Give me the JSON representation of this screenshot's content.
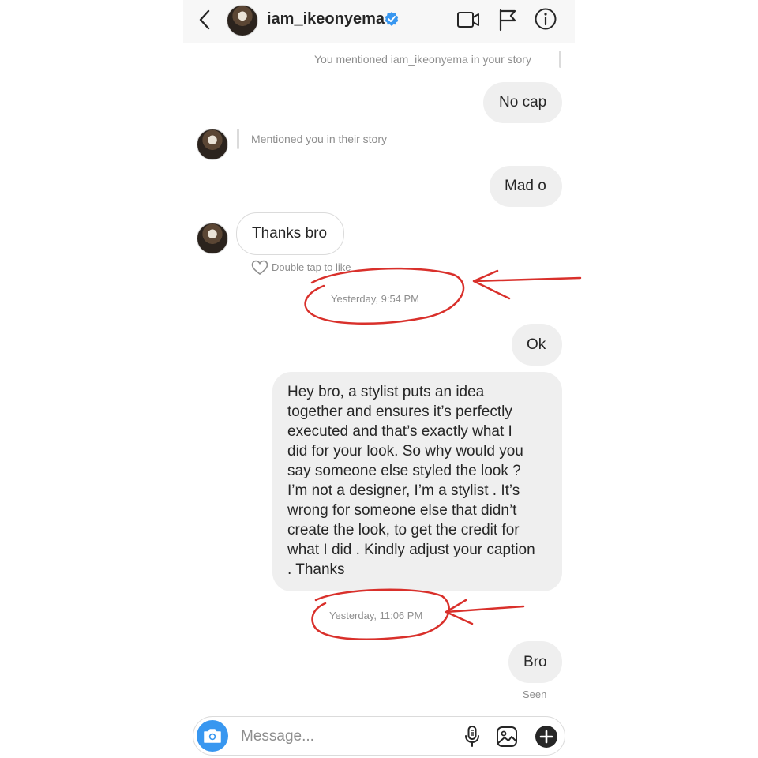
{
  "header": {
    "username": "iam_ikeonyema"
  },
  "messages": {
    "you_mentioned": "You mentioned iam_ikeonyema in your story",
    "no_cap": "No cap",
    "mentioned_you": "Mentioned you in their story",
    "mad_o": "Mad o",
    "thanks_bro": "Thanks bro",
    "double_tap": "Double tap to like",
    "time1": "Yesterday, 9:54 PM",
    "ok": "Ok",
    "long_lines": [
      "Hey bro, a stylist puts an idea",
      "together and ensures it’s perfectly",
      "executed and that’s exactly what I",
      "did for your look. So why would you",
      "say someone else styled the look ?",
      "I’m not a designer, I’m a stylist . It’s",
      "wrong for someone else that didn’t",
      "create the look, to get the credit for",
      "what I did . Kindly adjust your caption",
      ". Thanks"
    ],
    "time2": "Yesterday, 11:06 PM",
    "bro": "Bro",
    "seen": "Seen"
  },
  "composer": {
    "placeholder": "Message..."
  },
  "icons": {
    "back": "chevron-left-icon",
    "verified": "verified-badge-icon",
    "video": "video-call-icon",
    "flag": "flag-icon",
    "info": "info-icon",
    "camera": "camera-icon",
    "mic": "microphone-icon",
    "gallery": "gallery-icon",
    "plus": "plus-icon"
  },
  "colors": {
    "accent_blue": "#3897f0",
    "annotation_red": "#d9302b",
    "bubble_gray": "#efefef"
  }
}
